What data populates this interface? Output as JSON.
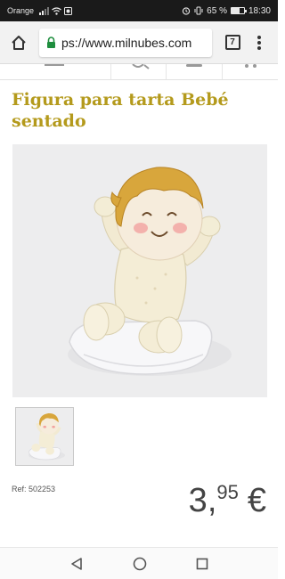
{
  "status_bar": {
    "carrier": "Orange",
    "battery": "65 %",
    "battery_level_percent": 65,
    "time": "18:30"
  },
  "browser": {
    "url": "ps://www.milnubes.com",
    "tab_count": "7"
  },
  "product": {
    "title": "Figura para tarta Bebé sentado",
    "ref": "Ref: 502253",
    "price": {
      "integer": "3",
      "separator": ",",
      "decimals": "95",
      "currency": "€"
    }
  },
  "colors": {
    "title": "#b49a1c",
    "image_bg": "#ededee",
    "status_bar": "#1a1a1a",
    "toolbar": "#f2f2f2",
    "secure_lock": "#1e8e3e"
  },
  "icons": {
    "toolbar": [
      "home-icon",
      "lock-icon",
      "tabs-icon",
      "menu-icon"
    ],
    "navbar": [
      "back-icon",
      "home-circle-icon",
      "recents-icon"
    ]
  }
}
